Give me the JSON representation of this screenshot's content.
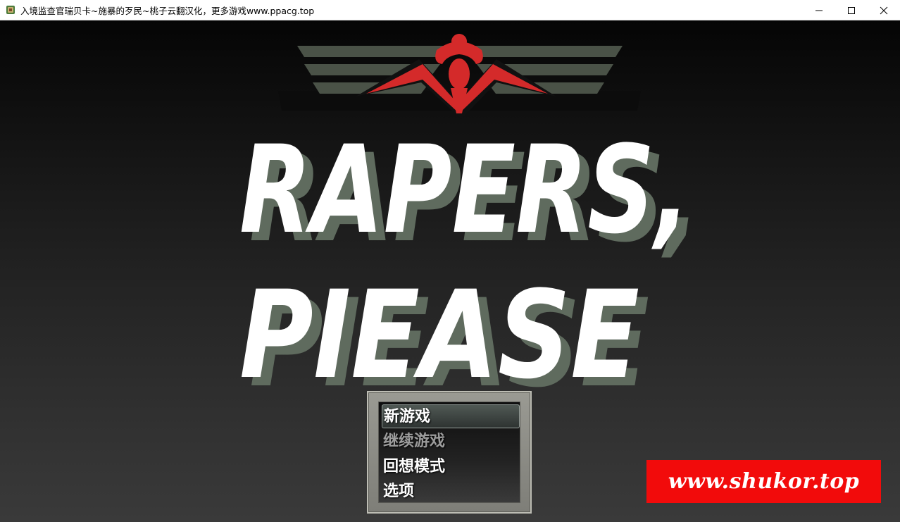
{
  "window": {
    "title": "入境监查官瑞贝卡~施暴的歹民~桃子云翻汉化，更多游戏www.ppacg.top",
    "icon": "app-icon",
    "controls": [
      "minimize-icon",
      "maximize-icon",
      "close-icon"
    ]
  },
  "logo": {
    "line1": "RAPERS,",
    "line2": "PIEASE",
    "emblem_icon": "winged-figure-emblem",
    "colors": {
      "text_fill": "#ffffff",
      "text_shadow": "#5f6b5e",
      "emblem_red": "#d42a2a",
      "stripes": "#4a5247"
    }
  },
  "menu": {
    "items": [
      {
        "label": "新游戏",
        "state": "selected"
      },
      {
        "label": "继续游戏",
        "state": "disabled"
      },
      {
        "label": "回想模式",
        "state": "normal"
      },
      {
        "label": "选项",
        "state": "normal"
      }
    ]
  },
  "watermark": {
    "text": "www.shukor.top",
    "color": "#f20b0b"
  }
}
